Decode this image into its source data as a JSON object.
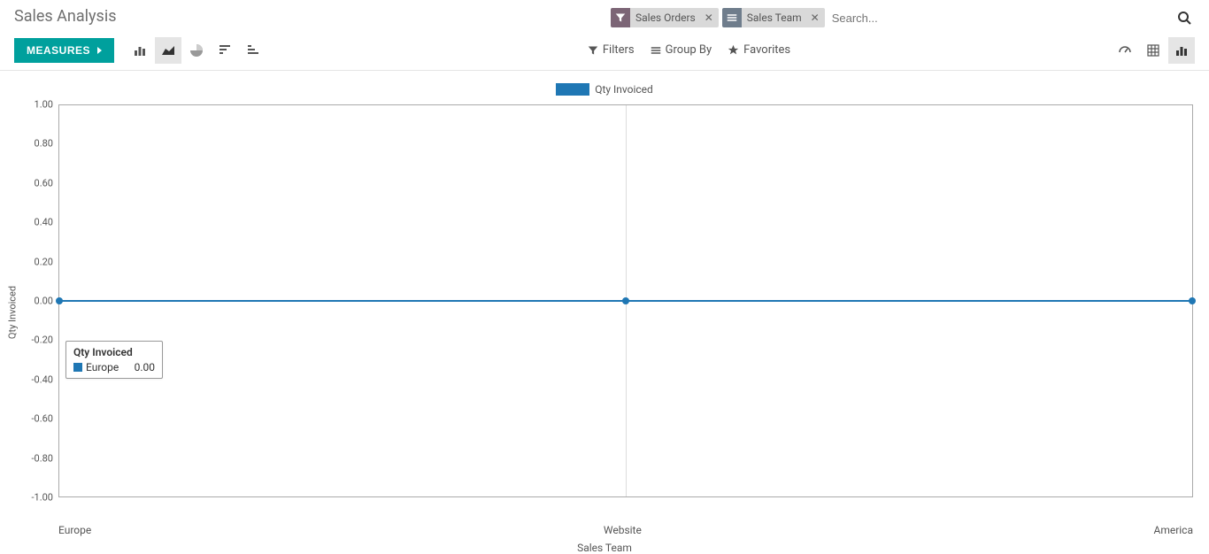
{
  "page_title": "Sales Analysis",
  "search": {
    "placeholder": "Search...",
    "facets": [
      {
        "type": "filter",
        "label": "Sales Orders"
      },
      {
        "type": "group",
        "label": "Sales Team"
      }
    ]
  },
  "toolbar": {
    "measures_label": "MEASURES",
    "filters_label": "Filters",
    "groupby_label": "Group By",
    "favorites_label": "Favorites"
  },
  "legend": {
    "series_name": "Qty Invoiced"
  },
  "tooltip": {
    "title": "Qty Invoiced",
    "category": "Europe",
    "value": "0.00"
  },
  "chart_data": {
    "type": "line",
    "xlabel": "Sales Team",
    "ylabel": "Qty Invoiced",
    "ylim": [
      -1.0,
      1.0
    ],
    "y_ticks": [
      "1.00",
      "0.80",
      "0.60",
      "0.40",
      "0.20",
      "0.00",
      "-0.20",
      "-0.40",
      "-0.60",
      "-0.80",
      "-1.00"
    ],
    "categories": [
      "Europe",
      "Website",
      "America"
    ],
    "series": [
      {
        "name": "Qty Invoiced",
        "values": [
          0.0,
          0.0,
          0.0
        ],
        "color": "#1f77b4"
      }
    ]
  }
}
